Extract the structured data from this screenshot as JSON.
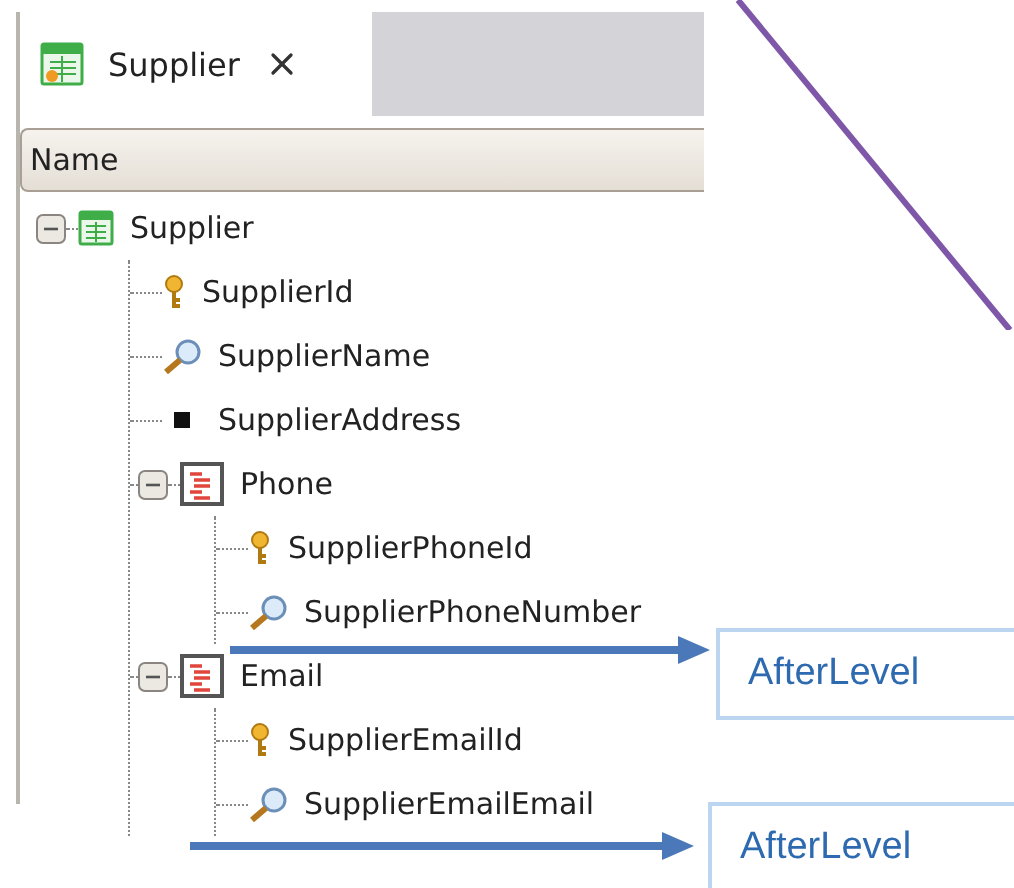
{
  "tab": {
    "title": "Supplier",
    "selected": true
  },
  "column_header": "Name",
  "tree": [
    {
      "label": "Supplier",
      "kind": "transaction",
      "expanded": true,
      "children": [
        {
          "label": "SupplierId",
          "kind": "key"
        },
        {
          "label": "SupplierName",
          "kind": "description"
        },
        {
          "label": "SupplierAddress",
          "kind": "attribute"
        },
        {
          "label": "Phone",
          "kind": "level",
          "expanded": true,
          "children": [
            {
              "label": "SupplierPhoneId",
              "kind": "key"
            },
            {
              "label": "SupplierPhoneNumber",
              "kind": "description"
            }
          ]
        },
        {
          "label": "Email",
          "kind": "level",
          "expanded": true,
          "children": [
            {
              "label": "SupplierEmailId",
              "kind": "key"
            },
            {
              "label": "SupplierEmailEmail",
              "kind": "description"
            }
          ]
        }
      ]
    }
  ],
  "callouts": [
    {
      "text": "AfterLevel"
    },
    {
      "text": "AfterLevel"
    }
  ]
}
